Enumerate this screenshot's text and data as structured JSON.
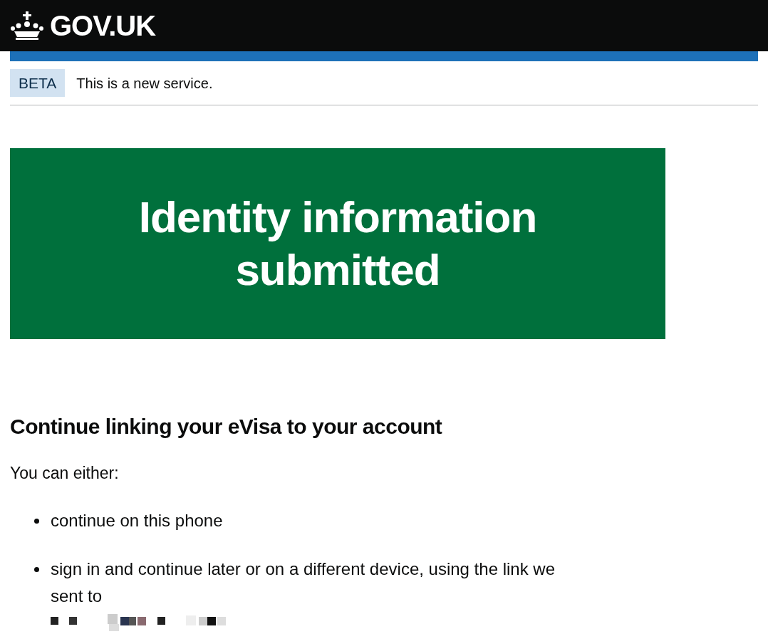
{
  "header": {
    "logo_text": "GOV.UK"
  },
  "phase_banner": {
    "tag": "BETA",
    "text": "This is a new service."
  },
  "panel": {
    "title": "Identity information submitted"
  },
  "heading": "Continue linking your eVisa to your account",
  "intro": "You can either:",
  "options": [
    {
      "text": "continue on this phone",
      "redacted": false
    },
    {
      "text": "sign in and continue later or on a different device, using the link we sent to",
      "redacted": true
    }
  ]
}
